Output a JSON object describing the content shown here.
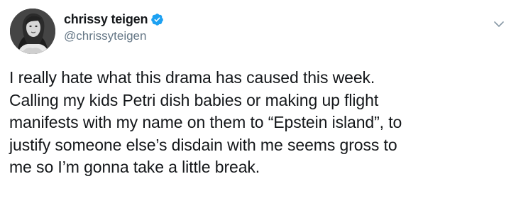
{
  "tweet": {
    "author": {
      "display_name": "chrissy teigen",
      "handle": "@chrissyteigen",
      "verified": true,
      "avatar_icon": "profile-photo"
    },
    "text": "I really hate what this drama has caused this week.\nCalling my kids Petri dish babies or making up flight\nmanifests with my name on them to “Epstein island”, to\njustify someone else’s disdain with me seems gross to\nme so I’m gonna take a little break.",
    "menu_icon": "chevron-down-icon"
  },
  "colors": {
    "text": "#14171a",
    "secondary_text": "#657786",
    "verified_blue": "#1da1f2",
    "background": "#ffffff"
  }
}
